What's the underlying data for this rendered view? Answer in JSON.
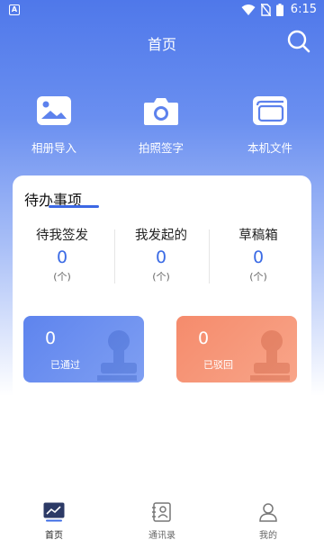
{
  "status_bar": {
    "time": "6:15",
    "left_icon_letter": "A"
  },
  "header": {
    "title": "首页"
  },
  "quick_actions": [
    {
      "label": "相册导入",
      "icon": "image-icon"
    },
    {
      "label": "拍照签字",
      "icon": "camera-icon"
    },
    {
      "label": "本机文件",
      "icon": "folder-icon"
    }
  ],
  "todo": {
    "title": "待办事项",
    "stats": [
      {
        "label": "待我签发",
        "value": "0",
        "unit": "(个)"
      },
      {
        "label": "我发起的",
        "value": "0",
        "unit": "(个)"
      },
      {
        "label": "草稿箱",
        "value": "0",
        "unit": "(个)"
      }
    ],
    "tiles": {
      "passed": {
        "value": "0",
        "label": "已通过"
      },
      "rejected": {
        "value": "0",
        "label": "已驳回"
      }
    }
  },
  "bottom_nav": [
    {
      "label": "首页",
      "icon": "chart-icon",
      "active": true
    },
    {
      "label": "通讯录",
      "icon": "contacts-icon",
      "active": false
    },
    {
      "label": "我的",
      "icon": "user-icon",
      "active": false
    }
  ],
  "colors": {
    "brand_blue": "#4f78ea",
    "accent_orange": "#f58b6c",
    "value_blue": "#3b6be5"
  }
}
